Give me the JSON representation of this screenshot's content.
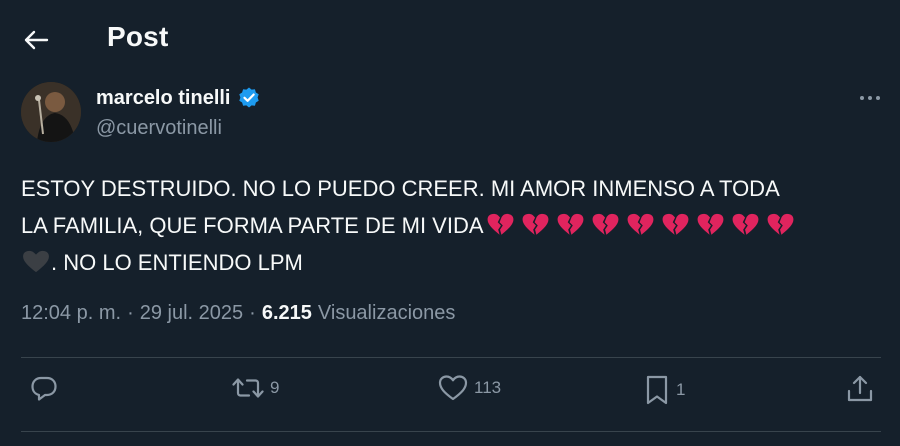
{
  "header": {
    "title": "Post"
  },
  "author": {
    "name": "marcelo tinelli",
    "handle": "@cuervotinelli",
    "verified": true
  },
  "tweet": {
    "line1": "ESTOY DESTRUIDO. NO LO PUEDO CREER. MI AMOR INMENSO A TODA",
    "line2": "LA FAMILIA, QUE FORMA PARTE DE MI VIDA",
    "broken_heart_count": 9,
    "line3": ". NO LO ENTIENDO LPM"
  },
  "meta": {
    "time": "12:04 p. m.",
    "separator": "·",
    "date": "29 jul. 2025",
    "views_count": "6.215",
    "views_label": "Visualizaciones"
  },
  "actions": {
    "replies": "",
    "reposts": "9",
    "likes": "113",
    "bookmarks": "1"
  },
  "colors": {
    "background": "#15202b",
    "text": "#f7f9f9",
    "muted": "#8b98a5",
    "divider": "#38444d",
    "verified": "#1d9bf0",
    "broken_heart": "#e0245e"
  }
}
